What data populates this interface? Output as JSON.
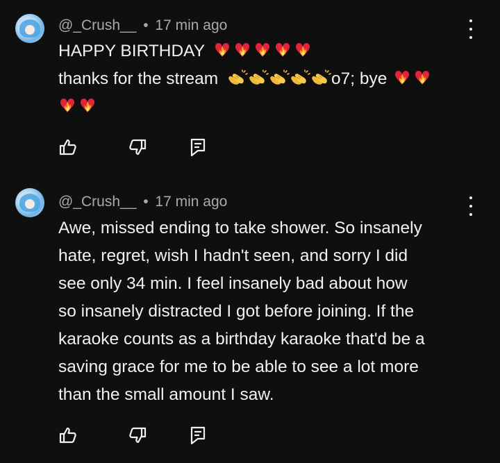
{
  "comments": [
    {
      "author": "@_Crush__",
      "separator": "•",
      "time": "17 min ago",
      "line1_text": "HAPPY BIRTHDAY",
      "line1_emoji": [
        "heart-on-fire",
        "heart-on-fire",
        "heart-on-fire",
        "heart-on-fire",
        "heart-on-fire"
      ],
      "line2_text_a": "thanks for the stream",
      "line2_emoji_a": [
        "clapping-hands",
        "clapping-hands",
        "clapping-hands",
        "clapping-hands",
        "clapping-hands"
      ],
      "line2_text_b": "o7; bye",
      "line2_emoji_b": [
        "heart-on-fire",
        "heart-on-fire"
      ],
      "line3_emoji": [
        "heart-on-fire",
        "heart-on-fire"
      ]
    },
    {
      "author": "@_Crush__",
      "separator": "•",
      "time": "17 min ago",
      "lines": [
        "Awe, missed ending to take shower. So insanely",
        "hate, regret, wish I hadn't seen, and sorry I did",
        "see only 34 min. I feel insanely bad about how",
        "so insanely distracted I got before joining. If the",
        "karaoke counts as a birthday karaoke that'd be a",
        "saving grace for me to be able to see a lot more",
        "than the small amount I saw."
      ]
    }
  ],
  "icons": {
    "like": "thumbs-up-icon",
    "dislike": "thumbs-down-icon",
    "reply": "reply-icon",
    "more": "more-vert-icon"
  },
  "colors": {
    "background": "#0f0f0f",
    "text": "#f1f1f1",
    "meta": "#aaaaaa"
  }
}
